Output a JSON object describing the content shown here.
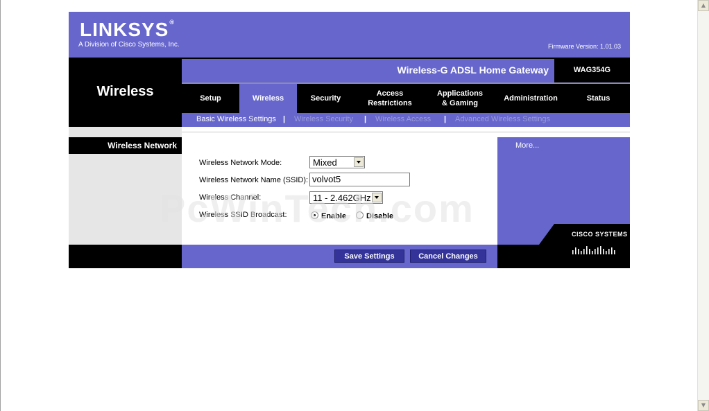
{
  "header": {
    "logo_text": "LINKSYS",
    "logo_reg": "®",
    "logo_subtitle": "A Division of Cisco Systems, Inc.",
    "firmware": "Firmware Version: 1.01.03",
    "product_name": "Wireless-G ADSL Home Gateway",
    "model": "WAG354G"
  },
  "section": {
    "title": "Wireless"
  },
  "tabs": [
    {
      "label": "Setup",
      "active": false
    },
    {
      "label": "Wireless",
      "active": true
    },
    {
      "label": "Security",
      "active": false
    },
    {
      "label": "Access Restrictions",
      "line1": "Access",
      "line2": "Restrictions",
      "active": false
    },
    {
      "label": "Applications & Gaming",
      "line1": "Applications",
      "line2": "& Gaming",
      "active": false
    },
    {
      "label": "Administration",
      "active": false
    },
    {
      "label": "Status",
      "active": false
    }
  ],
  "subnav": {
    "items": [
      {
        "label": "Basic Wireless Settings",
        "active": true
      },
      {
        "label": "Wireless Security",
        "active": false
      },
      {
        "label": "Wireless Access",
        "active": false
      },
      {
        "label": "Advanced Wireless Settings",
        "active": false
      }
    ],
    "separator": "|"
  },
  "sidebar": {
    "heading": "Wireless Network"
  },
  "form": {
    "mode_label": "Wireless Network Mode:",
    "mode_value": "Mixed",
    "ssid_label": "Wireless Network Name (SSID):",
    "ssid_value": "volvot5",
    "channel_label": "Wireless Channel:",
    "channel_value": "11 - 2.462GHz",
    "broadcast_label": "Wireless SSID Broadcast:",
    "broadcast_enable": "Enable",
    "broadcast_disable": "Disable",
    "broadcast_selected": "Enable"
  },
  "actions": {
    "save_label": "Save Settings",
    "cancel_label": "Cancel Changes"
  },
  "right": {
    "more_label": "More...",
    "cisco_text": "CISCO SYSTEMS"
  },
  "watermark": "PcWinTech.com",
  "colors": {
    "brand_purple": "#6666cc",
    "button_navy": "#333399",
    "inactive_subnav": "#9c9cdc"
  }
}
